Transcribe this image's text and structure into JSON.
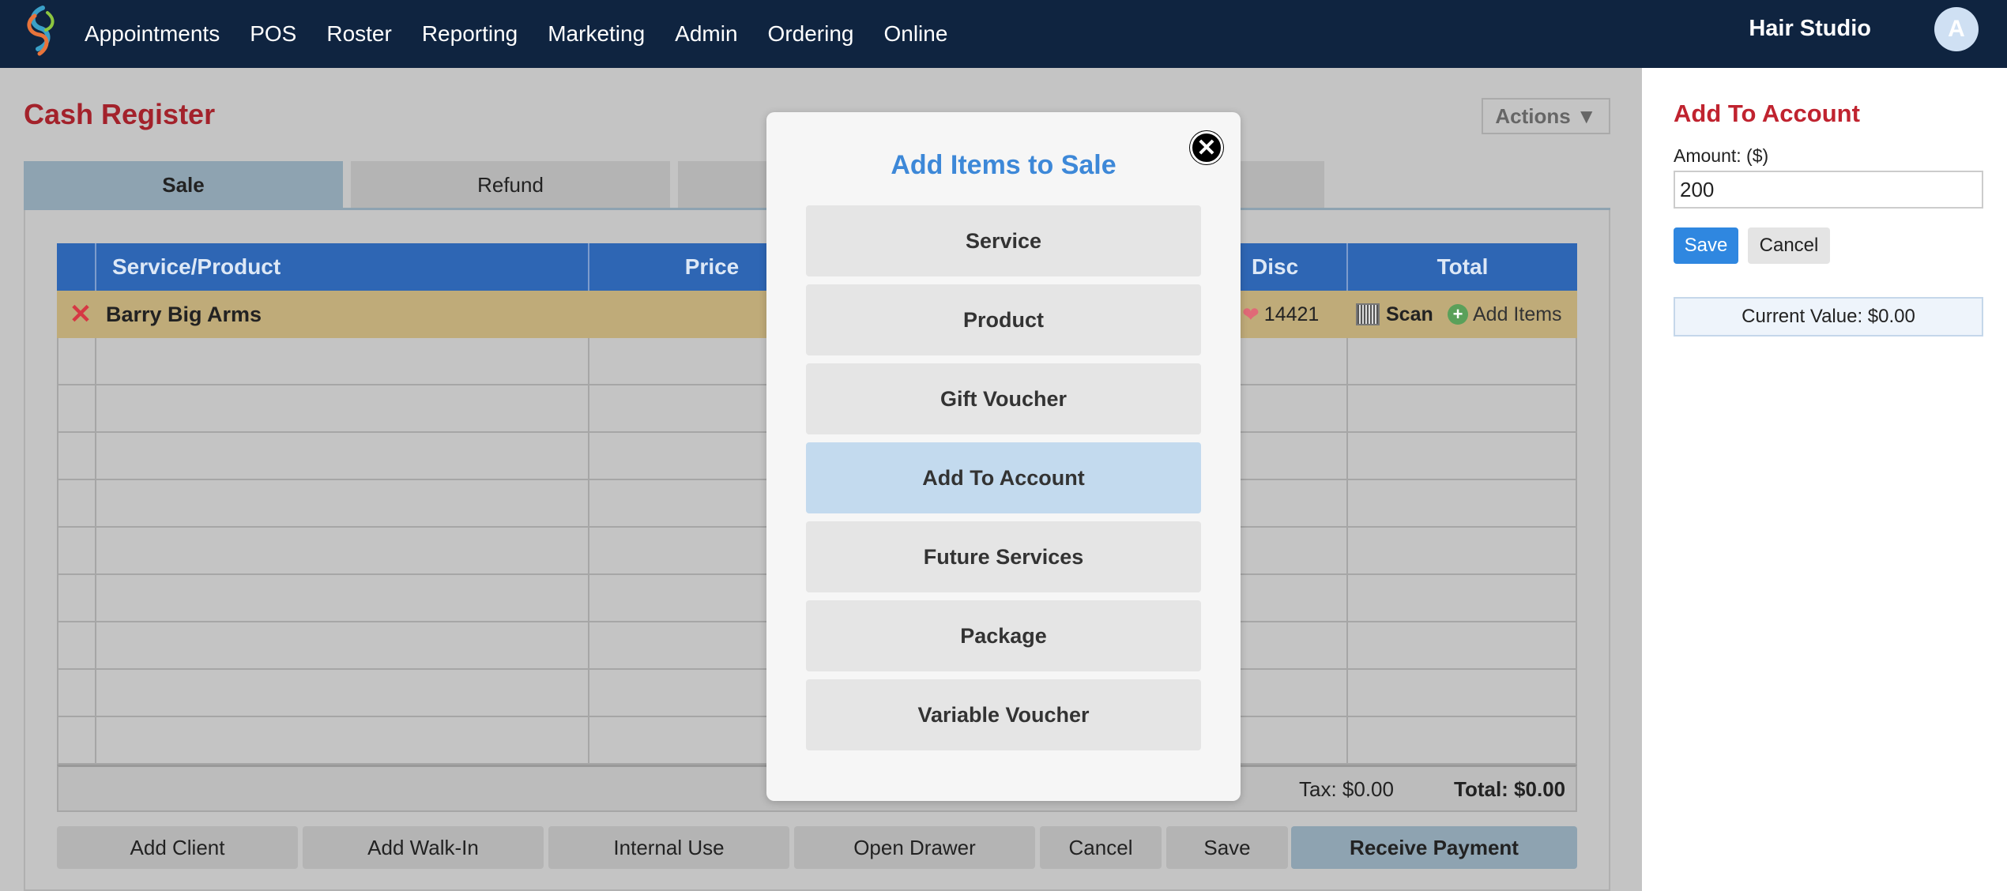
{
  "nav": {
    "items": [
      "Appointments",
      "POS",
      "Roster",
      "Reporting",
      "Marketing",
      "Admin",
      "Ordering",
      "Online"
    ],
    "studio_name": "Hair Studio",
    "avatar_initial": "A"
  },
  "page": {
    "title": "Cash Register",
    "actions_label": "Actions ▼",
    "tabs": [
      "Sale",
      "Refund"
    ]
  },
  "table": {
    "headers": {
      "service_product": "Service/Product",
      "price": "Price",
      "disc": "Disc",
      "total": "Total"
    },
    "client_row": {
      "name": "Barry Big Arms",
      "points": "14421",
      "scan_label": "Scan",
      "add_items_label": "Add Items"
    },
    "tax": "Tax: $0.00",
    "total": "Total: $0.00"
  },
  "bottom_buttons": [
    "Add Client",
    "Add Walk-In",
    "Internal Use",
    "Open Drawer",
    "Cancel",
    "Save",
    "Receive Payment"
  ],
  "side_panel": {
    "title": "Add To Account",
    "amount_label": "Amount: ($)",
    "amount_value": "200",
    "save_label": "Save",
    "cancel_label": "Cancel",
    "current_value": "Current Value: $0.00"
  },
  "modal": {
    "title": "Add Items to Sale",
    "close_icon": "close-icon",
    "options": [
      "Service",
      "Product",
      "Gift Voucher",
      "Add To Account",
      "Future Services",
      "Package",
      "Variable Voucher"
    ],
    "selected": "Add To Account"
  },
  "colors": {
    "nav_bg": "#0f2440",
    "title_red": "#a3222b",
    "table_header": "#2e66b4",
    "client_row": "#bfab79",
    "modal_title": "#3d88d8",
    "selected_option": "#c3daee",
    "save_blue": "#2f87e0"
  }
}
